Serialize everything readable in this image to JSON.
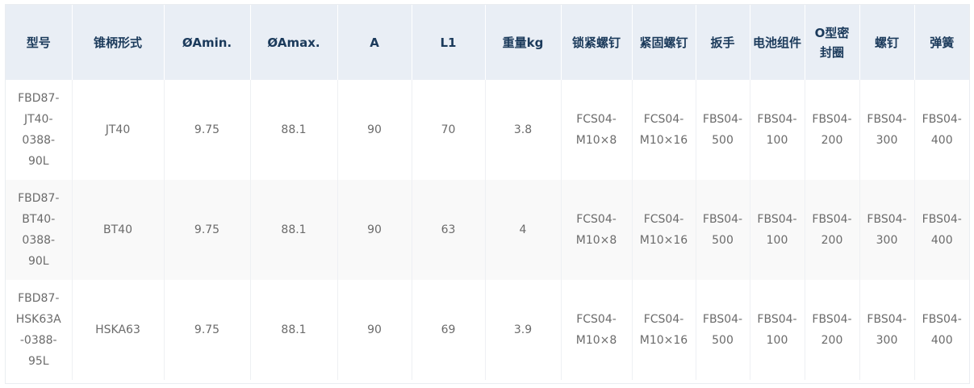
{
  "table": {
    "headers": [
      "型号",
      "锥柄形式",
      "ØAmin.",
      "ØAmax.",
      "A",
      "L1",
      "重量kg",
      "锁紧螺钉",
      "紧固螺钉",
      "扳手",
      "电池组件",
      "O型密封圈",
      "螺钉",
      "弹簧"
    ],
    "rows": [
      [
        "FBD87-JT40-0388-90L",
        "JT40",
        "9.75",
        "88.1",
        "90",
        "70",
        "3.8",
        "FCS04-M10×8",
        "FCS04-M10×16",
        "FBS04-500",
        "FBS04-100",
        "FBS04-200",
        "FBS04-300",
        "FBS04-400"
      ],
      [
        "FBD87-BT40-0388-90L",
        "BT40",
        "9.75",
        "88.1",
        "90",
        "63",
        "4",
        "FCS04-M10×8",
        "FCS04-M10×16",
        "FBS04-500",
        "FBS04-100",
        "FBS04-200",
        "FBS04-300",
        "FBS04-400"
      ],
      [
        "FBD87-HSK63A-0388-95L",
        "HSKA63",
        "9.75",
        "88.1",
        "90",
        "69",
        "3.9",
        "FCS04-M10×8",
        "FCS04-M10×16",
        "FBS04-500",
        "FBS04-100",
        "FBS04-200",
        "FBS04-300",
        "FBS04-400"
      ]
    ]
  }
}
